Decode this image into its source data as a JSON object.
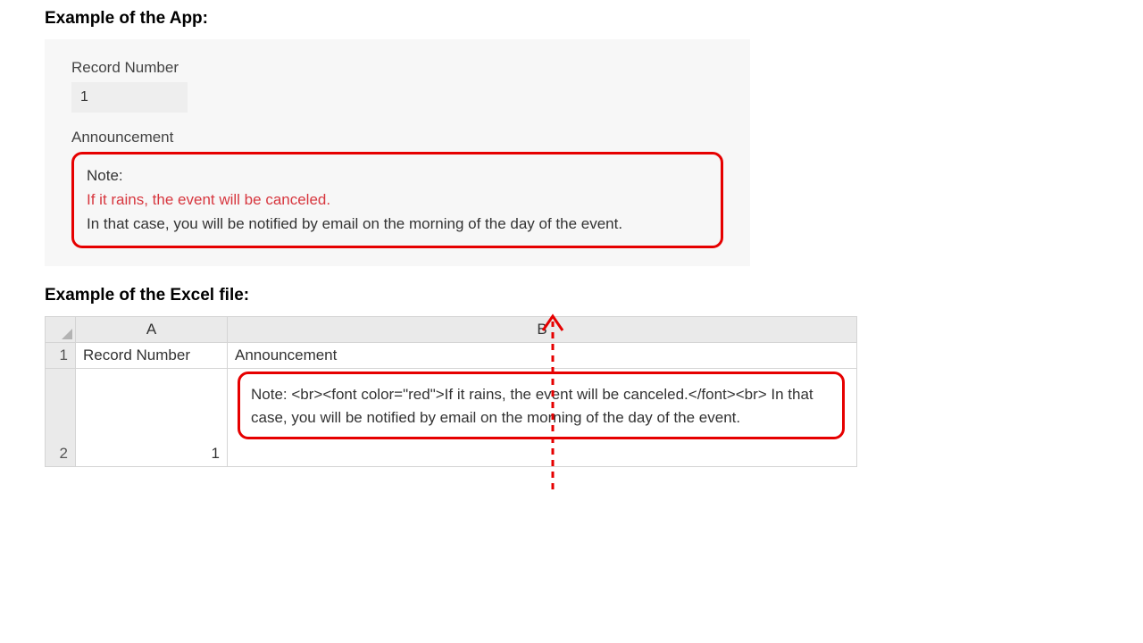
{
  "headings": {
    "app": "Example of the App:",
    "excel": "Example of the Excel file:"
  },
  "app": {
    "record_number_label": "Record Number",
    "record_number_value": "1",
    "announcement_label": "Announcement",
    "note_line1": "Note:",
    "note_line2": "If it rains, the event will be canceled.",
    "note_line3": "In that case, you will be notified by email on the morning of the day of the event."
  },
  "excel": {
    "col_letters": {
      "a": "A",
      "b": "B"
    },
    "row_numbers": {
      "r1": "1",
      "r2": "2"
    },
    "r1": {
      "a": "Record Number",
      "b": "Announcement"
    },
    "r2": {
      "a": "1",
      "b": "Note: <br><font color=\"red\">If it rains, the event will be canceled.</font><br> In that case, you will be notified by email on the morning of the day of the event."
    }
  },
  "colors": {
    "accent_red": "#e60000"
  }
}
